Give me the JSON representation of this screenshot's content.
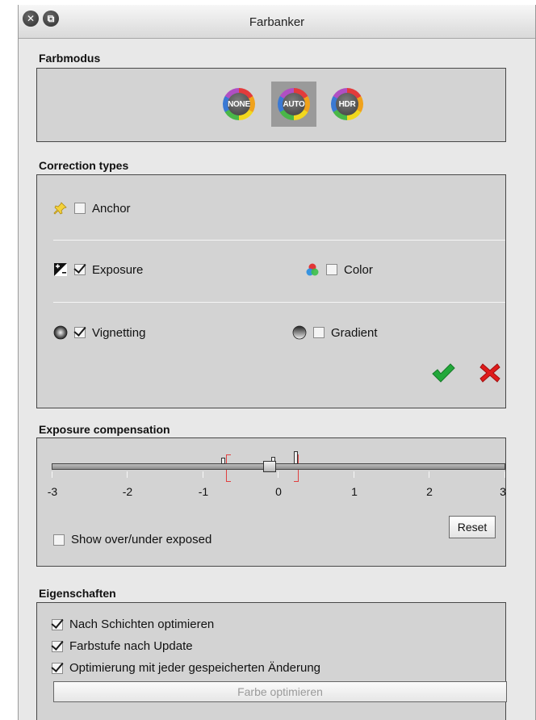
{
  "window": {
    "title": "Farbanker"
  },
  "farbmodus": {
    "label": "Farbmodus",
    "modes": [
      {
        "label": "NONE",
        "selected": false
      },
      {
        "label": "AUTO",
        "selected": true
      },
      {
        "label": "HDR",
        "selected": false
      }
    ]
  },
  "correction": {
    "label": "Correction types",
    "anchor": {
      "label": "Anchor",
      "checked": false
    },
    "exposure": {
      "label": "Exposure",
      "checked": true
    },
    "color": {
      "label": "Color",
      "checked": false
    },
    "vignetting": {
      "label": "Vignetting",
      "checked": true
    },
    "gradient": {
      "label": "Gradient",
      "checked": false
    }
  },
  "exposure_comp": {
    "label": "Exposure compensation",
    "ticks": [
      "-3",
      "-2",
      "-1",
      "0",
      "1",
      "2",
      "3"
    ],
    "value": 0,
    "show_over_under": {
      "label": "Show over/under exposed",
      "checked": false
    },
    "reset_label": "Reset"
  },
  "eigenschaften": {
    "label": "Eigenschaften",
    "options": [
      {
        "label": "Nach Schichten optimieren",
        "checked": true
      },
      {
        "label": "Farbstufe nach Update",
        "checked": true
      },
      {
        "label": "Optimierung mit jeder gespeicherten Änderung",
        "checked": true
      }
    ],
    "optimize_button": "Farbe optimieren"
  },
  "colors": {
    "accept": "#22a83a",
    "reject": "#e01b1b",
    "panel": "#d3d3d3"
  }
}
